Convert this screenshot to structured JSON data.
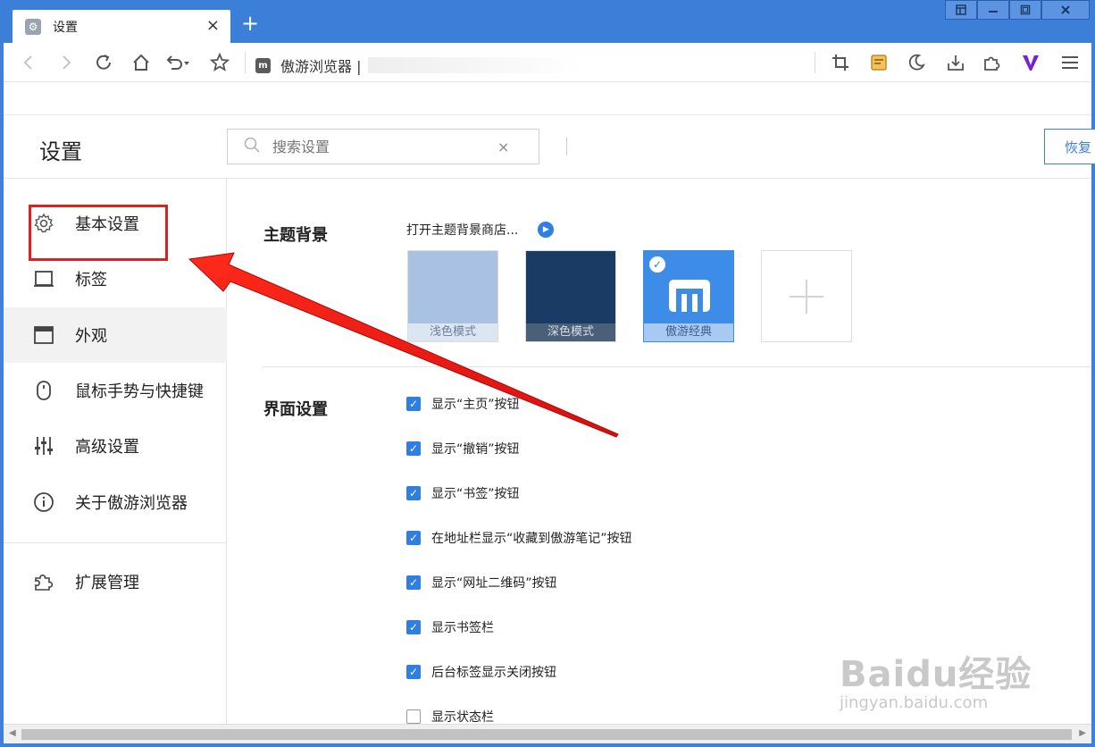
{
  "window": {
    "tab_title": "设置",
    "tab_close": "×",
    "new_tab": "+"
  },
  "navbar": {
    "address_text": "傲游浏览器 |",
    "favicon_letter": "m"
  },
  "settings": {
    "title": "设置",
    "search_placeholder": "搜索设置",
    "search_clear": "×",
    "restore_label": "恢复"
  },
  "sidebar": {
    "items": [
      {
        "label": "基本设置",
        "icon": "gear-icon"
      },
      {
        "label": "标签",
        "icon": "tab-icon"
      },
      {
        "label": "外观",
        "icon": "window-icon"
      },
      {
        "label": "鼠标手势与快捷键",
        "icon": "mouse-icon"
      },
      {
        "label": "高级设置",
        "icon": "sliders-icon"
      },
      {
        "label": "关于傲游浏览器",
        "icon": "info-icon"
      },
      {
        "label": "扩展管理",
        "icon": "puzzle-icon"
      }
    ],
    "active_index": 2
  },
  "theme": {
    "section_title": "主题背景",
    "store_link": "打开主题背景商店...",
    "cards": [
      {
        "caption": "浅色模式",
        "color": "#a9c1e2",
        "selected": false
      },
      {
        "caption": "深色模式",
        "color": "#1a3b63",
        "selected": false
      },
      {
        "caption": "傲游经典",
        "color": "#3d8ce8",
        "selected": true
      }
    ]
  },
  "interface": {
    "section_title": "界面设置",
    "options": [
      {
        "label": "显示“主页”按钮",
        "checked": true
      },
      {
        "label": "显示“撤销”按钮",
        "checked": true
      },
      {
        "label": "显示“书签”按钮",
        "checked": true
      },
      {
        "label": "在地址栏显示“收藏到傲游笔记”按钮",
        "checked": true
      },
      {
        "label": "显示“网址二维码”按钮",
        "checked": true
      },
      {
        "label": "显示书签栏",
        "checked": true
      },
      {
        "label": "后台标签显示关闭按钮",
        "checked": true
      },
      {
        "label": "显示状态栏",
        "checked": false
      }
    ]
  },
  "watermark": {
    "brand": "Baidu经验",
    "url": "jingyan.baidu.com"
  },
  "colors": {
    "accent": "#2f7ee2",
    "frame": "#3b7fd9",
    "annotation": "#e21e1e"
  }
}
